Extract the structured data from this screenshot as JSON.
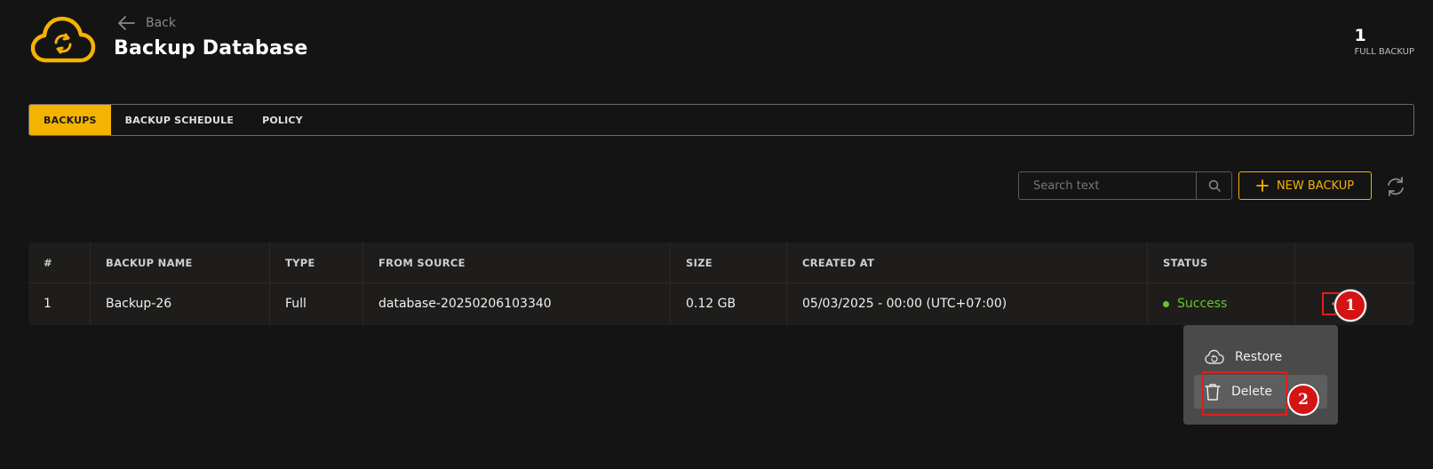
{
  "header": {
    "back_label": "Back",
    "title": "Backup Database",
    "stat_value": "1",
    "stat_label": "FULL BACKUP"
  },
  "tabs": [
    {
      "label": "BACKUPS",
      "active": true
    },
    {
      "label": "BACKUP SCHEDULE",
      "active": false
    },
    {
      "label": "POLICY",
      "active": false
    }
  ],
  "toolbar": {
    "search_placeholder": "Search text",
    "new_backup_label": "NEW BACKUP"
  },
  "table": {
    "columns": [
      "#",
      "BACKUP NAME",
      "TYPE",
      "FROM SOURCE",
      "SIZE",
      "CREATED AT",
      "STATUS",
      ""
    ],
    "rows": [
      {
        "index": "1",
        "name": "Backup-26",
        "type": "Full",
        "source": "database-20250206103340",
        "size": "0.12 GB",
        "created_at": "05/03/2025 - 00:00 (UTC+07:00)",
        "status": "Success"
      }
    ]
  },
  "menu": {
    "restore_label": "Restore",
    "delete_label": "Delete"
  },
  "annotations": {
    "step1": "1",
    "step2": "2"
  },
  "colors": {
    "accent": "#f5b301",
    "success": "#6cc32c",
    "highlight": "#e11d1d",
    "background": "#141414"
  },
  "icons": [
    "cloud-sync-icon",
    "back-arrow-icon",
    "search-icon",
    "plus-icon",
    "refresh-icon",
    "more-dots-icon",
    "cloud-restore-icon",
    "trash-icon"
  ]
}
